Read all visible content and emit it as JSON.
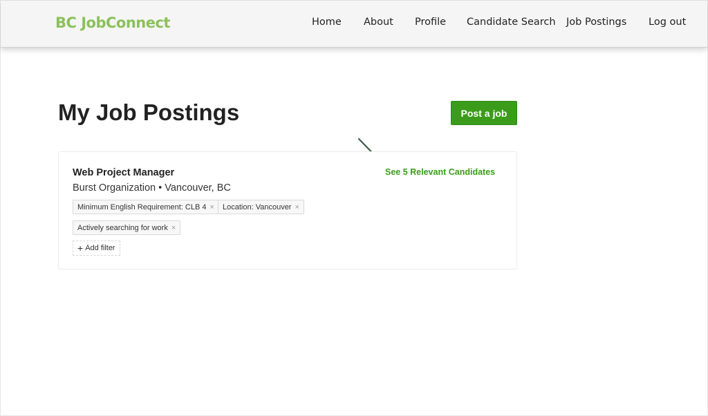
{
  "header": {
    "logo": "BC JobConnect",
    "nav": [
      "Home",
      "About",
      "Profile",
      "Candidate Search",
      "Job Postings",
      "Log out"
    ]
  },
  "main": {
    "title": "My Job Postings",
    "post_button": "Post a job",
    "postings": [
      {
        "title": "Web Project Manager",
        "subtitle": "Burst Organization • Vancouver, BC",
        "candidates_link": "See 5 Relevant Candidates",
        "filters": [
          "Minimum English Requirement: CLB 4",
          "Location: Vancouver",
          "Actively searching for work"
        ],
        "add_filter": "Add filter"
      }
    ]
  },
  "icons": {
    "remove": "×",
    "plus": "+"
  },
  "colors": {
    "brand": "#8bc15b",
    "accent": "#3a9c1a",
    "annotation_arrow": "#3d5a48"
  }
}
